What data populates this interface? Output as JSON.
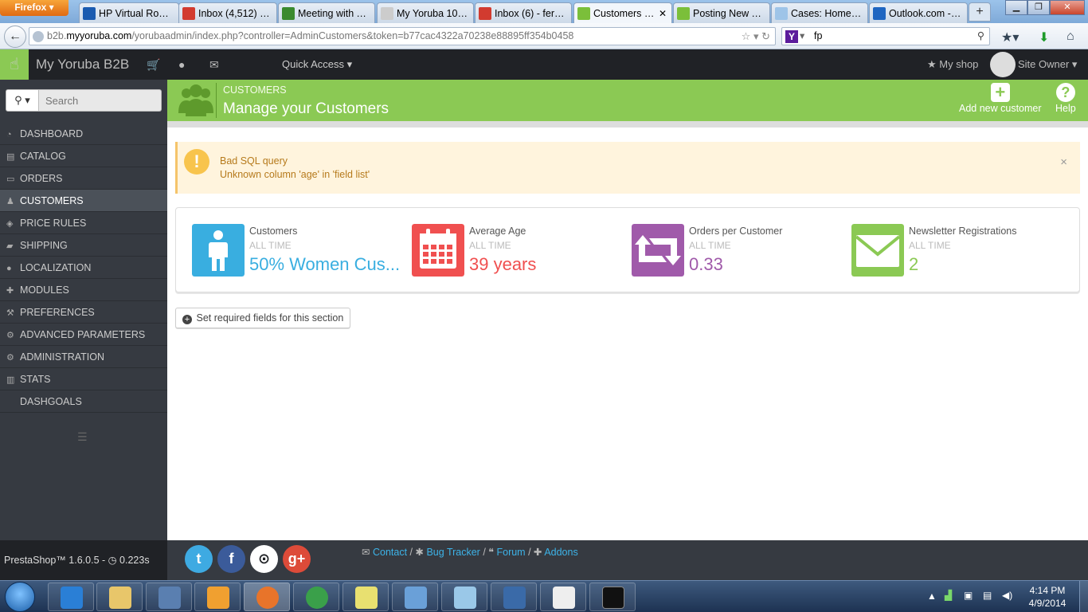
{
  "browser": {
    "app_button": "Firefox",
    "tabs": [
      {
        "title": "HP Virtual Rooms",
        "icon": "hp-icon",
        "color": "#1a5bb0"
      },
      {
        "title": "Inbox (4,512) - f...",
        "icon": "gmail-icon",
        "color": "#d23b2f"
      },
      {
        "title": "Meeting with Yo...",
        "icon": "globe-icon",
        "color": "#3a8a2e"
      },
      {
        "title": "My Yoruba 101 | ...",
        "icon": "page-icon",
        "color": "#cccccc"
      },
      {
        "title": "Inbox (6) - ferna...",
        "icon": "gmail-icon",
        "color": "#d23b2f"
      },
      {
        "title": "Customers • ...",
        "icon": "prestashop-icon",
        "color": "#7bbf3a"
      },
      {
        "title": "Posting New To...",
        "icon": "prestashop-icon",
        "color": "#7bbf3a"
      },
      {
        "title": "Cases: Home ~ ...",
        "icon": "cloud-icon",
        "color": "#9ec4e8"
      },
      {
        "title": "Outlook.com - f...",
        "icon": "outlook-icon",
        "color": "#1f66c1"
      }
    ],
    "url_prefix": "b2b.",
    "url_host": "myyoruba.com",
    "url_path": "/yorubaadmin/index.php?controller=AdminCustomers&token=b77cac4322a70238e88895ff354b0458",
    "search_value": "fp"
  },
  "admin": {
    "shop_name": "My Yoruba B2B",
    "quick_access": "Quick Access",
    "my_shop": "My shop",
    "user": "Site Owner"
  },
  "sidebar": {
    "search_placeholder": "Search",
    "items": [
      {
        "label": "DASHBOARD",
        "icon": "dashboard-icon",
        "glyph": "◔"
      },
      {
        "label": "CATALOG",
        "icon": "book-icon",
        "glyph": "▤"
      },
      {
        "label": "ORDERS",
        "icon": "credit-card-icon",
        "glyph": "▭"
      },
      {
        "label": "CUSTOMERS",
        "icon": "users-icon",
        "glyph": "♟",
        "active": true
      },
      {
        "label": "PRICE RULES",
        "icon": "tags-icon",
        "glyph": "◈"
      },
      {
        "label": "SHIPPING",
        "icon": "truck-icon",
        "glyph": "▰"
      },
      {
        "label": "LOCALIZATION",
        "icon": "globe-icon",
        "glyph": "●"
      },
      {
        "label": "MODULES",
        "icon": "puzzle-icon",
        "glyph": "✚"
      },
      {
        "label": "PREFERENCES",
        "icon": "wrench-icon",
        "glyph": "⚒"
      },
      {
        "label": "ADVANCED PARAMETERS",
        "icon": "cogs-icon",
        "glyph": "⚙"
      },
      {
        "label": "ADMINISTRATION",
        "icon": "cog-icon",
        "glyph": "⚙"
      },
      {
        "label": "STATS",
        "icon": "bar-chart-icon",
        "glyph": "▥"
      },
      {
        "label": "DASHGOALS",
        "icon": "",
        "glyph": ""
      }
    ]
  },
  "toolbar": {
    "breadcrumb": "CUSTOMERS",
    "title": "Manage your Customers",
    "add_label": "Add new customer",
    "help_label": "Help"
  },
  "alert": {
    "title": "Bad SQL query",
    "message": "Unknown column 'age' in 'field list'"
  },
  "kpis": [
    {
      "title": "Customers",
      "subtitle": "ALL TIME",
      "value": "50% Women Cus...",
      "color": "#39aee0",
      "icon": "male-icon"
    },
    {
      "title": "Average Age",
      "subtitle": "ALL TIME",
      "value": "39 years",
      "color": "#f05050",
      "icon": "calendar-icon"
    },
    {
      "title": "Orders per Customer",
      "subtitle": "ALL TIME",
      "value": "0.33",
      "color": "#a05aaa",
      "icon": "retweet-icon"
    },
    {
      "title": "Newsletter Registrations",
      "subtitle": "ALL TIME",
      "value": "2",
      "color": "#8bc954",
      "icon": "envelope-icon"
    }
  ],
  "required_fields_button": "Set required fields for this section",
  "footer": {
    "version": "PrestaShop™ 1.6.0.5 - ",
    "load_time": "0.223s",
    "links": [
      "Contact",
      "Bug Tracker",
      "Forum",
      "Addons"
    ]
  },
  "taskbar": {
    "time": "4:14 PM",
    "date": "4/9/2014"
  }
}
